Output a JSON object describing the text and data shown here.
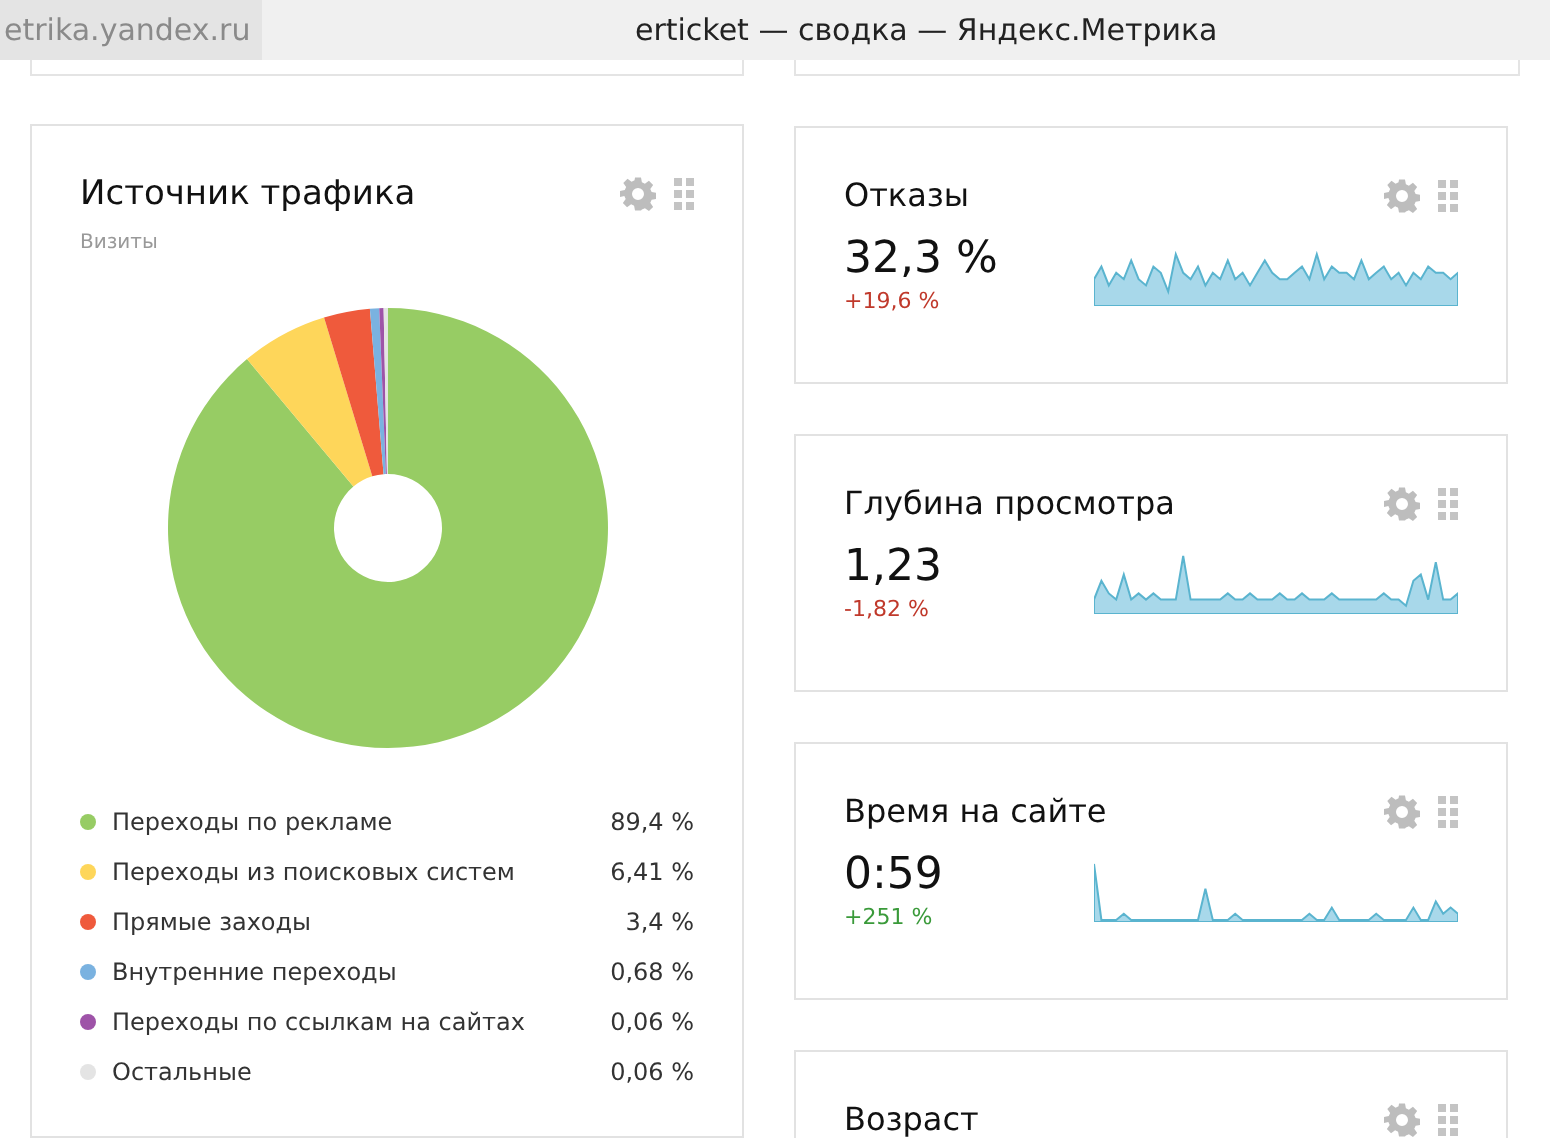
{
  "browser": {
    "address": "etrika.yandex.ru",
    "title": "erticket — сводка — Яндекс.Метрика"
  },
  "traffic_card": {
    "title": "Источник трафика",
    "chart_data": {
      "type": "donut",
      "categories": [
        "Переходы по рекламе",
        "Переходы из поисковых систем",
        "Прямые заходы",
        "Внутренние переходы",
        "Переходы по ссылкам на сайтах",
        "Остальные"
      ],
      "series": [
        {
          "name": "Визиты",
          "values": [
            89.4,
            6.41,
            3.4,
            0.68,
            0.06,
            0.06
          ]
        }
      ]
    },
    "legend": [
      {
        "value": "89,4 %",
        "color": "#97cc64"
      },
      {
        "value": "6,41 %",
        "color": "#fed65a"
      },
      {
        "value": "3,4 %",
        "color": "#ef5a3c"
      },
      {
        "value": "0,68 %",
        "color": "#7ab2e0"
      },
      {
        "value": "0,06 %",
        "color": "#9e53a8"
      },
      {
        "value": "0,06 %",
        "color": "#e4e4e4"
      }
    ]
  },
  "metric_cards": [
    {
      "title": "Отказы",
      "value": "32,3 %",
      "delta": "+19,6 %",
      "negative": true
    },
    {
      "title": "Глубина просмотра",
      "value": "1,23",
      "delta": "-1,82 %",
      "negative": true
    },
    {
      "title": "Время на сайте",
      "value": "0:59",
      "delta": "+251 %",
      "negative": false
    },
    {
      "title": "Возраст"
    }
  ]
}
